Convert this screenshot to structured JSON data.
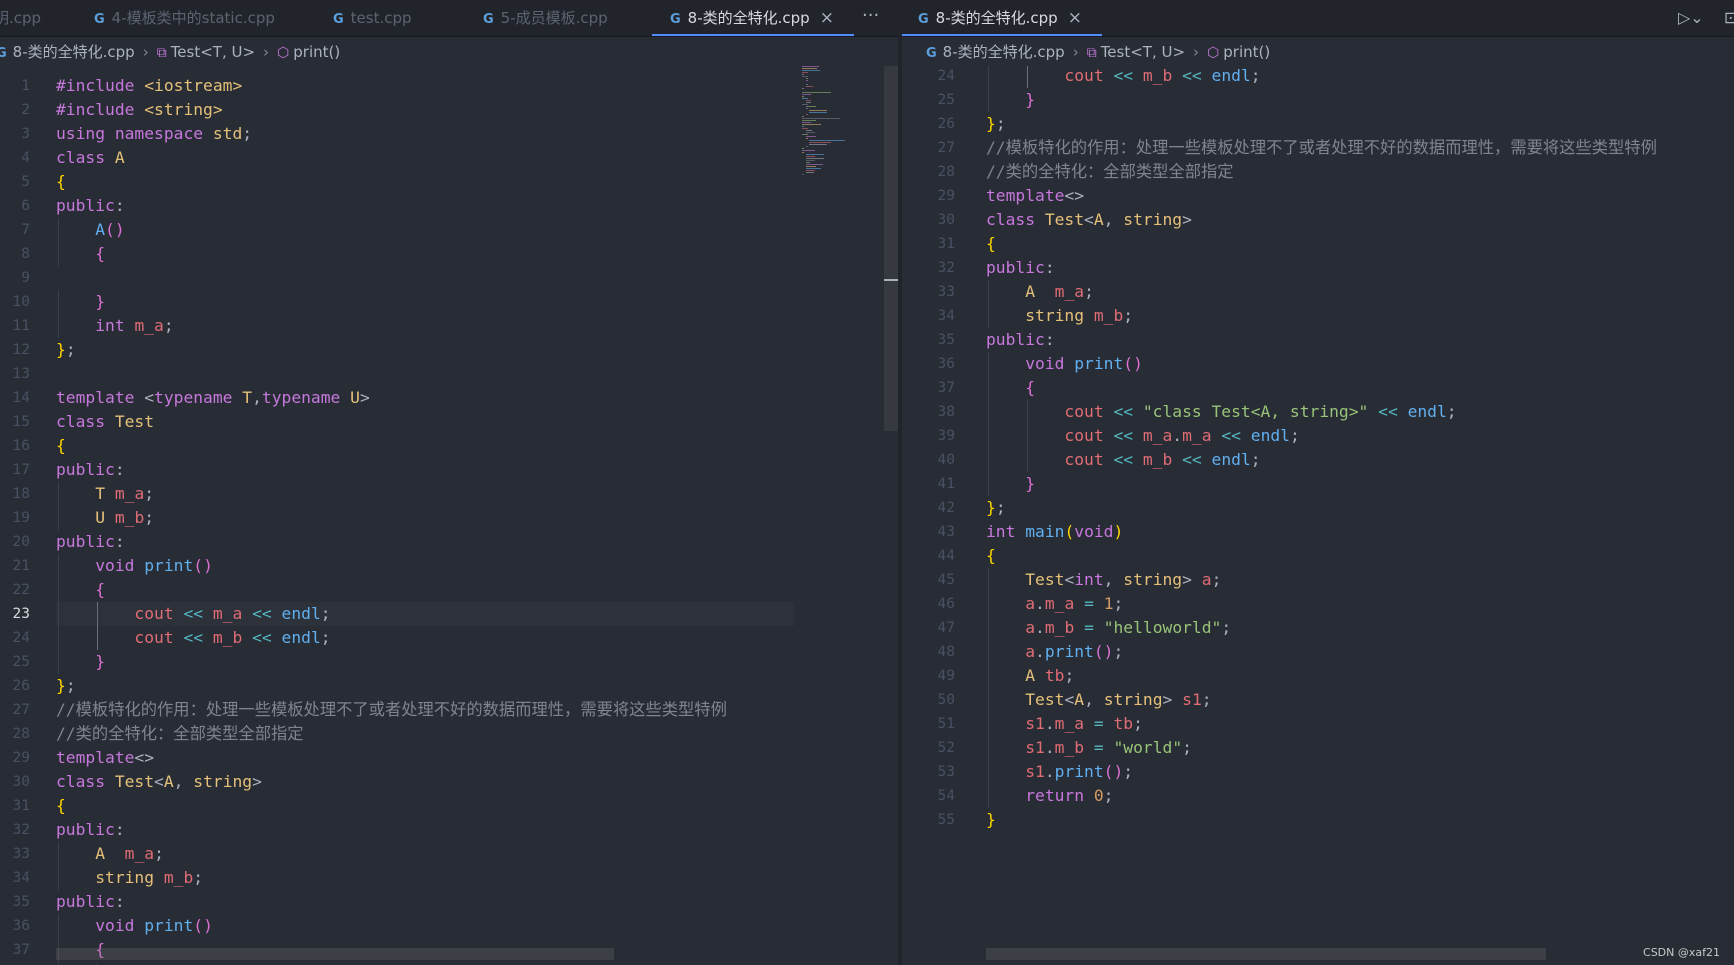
{
  "left_tabs": [
    {
      "label": "明.cpp",
      "active": false
    },
    {
      "label": "4-模板类中的static.cpp",
      "active": false
    },
    {
      "label": "test.cpp",
      "active": false
    },
    {
      "label": "5-成员模板.cpp",
      "active": false
    },
    {
      "label": "8-类的全特化.cpp",
      "active": true
    }
  ],
  "right_tabs": [
    {
      "label": "8-类的全特化.cpp",
      "active": true
    }
  ],
  "tab_icon": "G",
  "close_glyph": "×",
  "more_glyph": "···",
  "breadcrumb": {
    "file": "8-类的全特化.cpp",
    "class": "Test<T, U>",
    "method": "print()"
  },
  "line_numbers": [
    "1",
    "2",
    "3",
    "4",
    "5",
    "6",
    "7",
    "8",
    "9",
    "10",
    "11",
    "12",
    "13",
    "14",
    "15",
    "16",
    "17",
    "18",
    "19",
    "20",
    "21",
    "22",
    "23",
    "24",
    "25",
    "26",
    "27",
    "28",
    "29",
    "30",
    "31",
    "32",
    "33",
    "34",
    "35",
    "36",
    "37",
    "38",
    "39",
    "40",
    "41",
    "42",
    "43",
    "44",
    "45",
    "46",
    "47",
    "48",
    "49",
    "50",
    "51",
    "52",
    "53",
    "54",
    "55"
  ],
  "code": [
    "#include <iostream>",
    "#include <string>",
    "using namespace std;",
    "class A",
    "{",
    "public:",
    "    A()",
    "    {",
    "",
    "    }",
    "    int m_a;",
    "};",
    "",
    "template <typename T,typename U>",
    "class Test",
    "{",
    "public:",
    "    T m_a;",
    "    U m_b;",
    "public:",
    "    void print()",
    "    {",
    "        cout << m_a << endl;",
    "        cout << m_b << endl;",
    "    }",
    "};",
    "//模板特化的作用：处理一些模板处理不了或者处理不好的数据而理性，需要将这些类型特例",
    "//类的全特化：全部类型全部指定",
    "template<>",
    "class Test<A, string>",
    "{",
    "public:",
    "    A  m_a;",
    "    string m_b;",
    "public:",
    "    void print()",
    "    {",
    "        cout << \"class Test<A, string>\" << endl;",
    "        cout << m_a.m_a << endl;",
    "        cout << m_b << endl;",
    "    }",
    "};",
    "int main(void)",
    "{",
    "    Test<int, string> a;",
    "    a.m_a = 1;",
    "    a.m_b = \"helloworld\";",
    "    a.print();",
    "    A tb;",
    "    Test<A, string> s1;",
    "    s1.m_a = tb;",
    "    s1.m_b = \"world\";",
    "    s1.print();",
    "    return 0;",
    "}"
  ],
  "left_view": {
    "first_line": 1,
    "last_line": 38,
    "current_line": 23
  },
  "right_view": {
    "first_line": 24,
    "last_line": 55
  },
  "watermark": "CSDN @xaf21",
  "colors": {
    "background": "#282c34",
    "keyword": "#c678dd",
    "type": "#e5c07b",
    "function": "#61afef",
    "variable": "#e06c75",
    "string": "#98c379",
    "number": "#d19a66",
    "operator": "#56b6c2",
    "comment": "#7f848e",
    "accent": "#528bff"
  }
}
